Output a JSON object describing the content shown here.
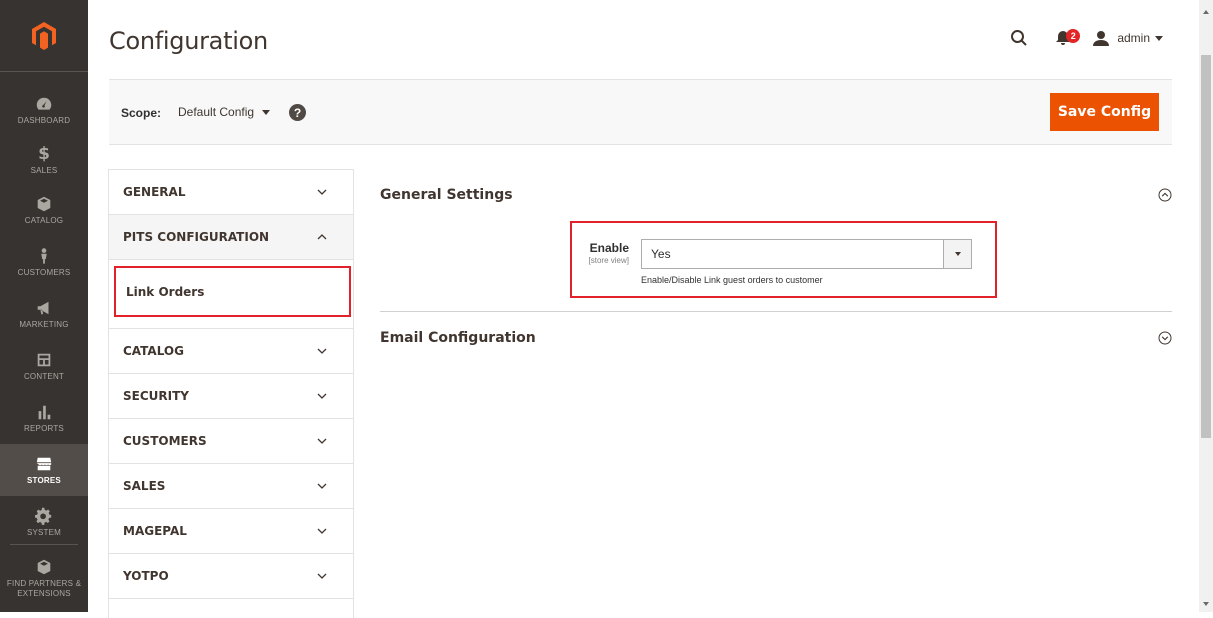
{
  "menu": {
    "items": [
      {
        "label": "DASHBOARD",
        "icon": "dashboard-icon"
      },
      {
        "label": "SALES",
        "icon": "dollar-icon"
      },
      {
        "label": "CATALOG",
        "icon": "box-icon"
      },
      {
        "label": "CUSTOMERS",
        "icon": "person-icon"
      },
      {
        "label": "MARKETING",
        "icon": "megaphone-icon"
      },
      {
        "label": "CONTENT",
        "icon": "layout-icon"
      },
      {
        "label": "REPORTS",
        "icon": "bar-chart-icon"
      },
      {
        "label": "STORES",
        "icon": "store-icon"
      },
      {
        "label": "SYSTEM",
        "icon": "gear-icon"
      },
      {
        "label": "FIND PARTNERS & EXTENSIONS",
        "icon": "cube-icon"
      }
    ],
    "active": "STORES"
  },
  "header": {
    "title": "Configuration",
    "notification_count": "2",
    "user": "admin"
  },
  "scope": {
    "label": "Scope:",
    "value": "Default Config",
    "help": "?",
    "save_label": "Save Config"
  },
  "tabs": {
    "items": [
      "GENERAL",
      "PITS CONFIGURATION",
      "CATALOG",
      "SECURITY",
      "CUSTOMERS",
      "SALES",
      "MAGEPAL",
      "YOTPO"
    ],
    "subitem": "Link Orders"
  },
  "sections": {
    "general": {
      "title": "General Settings",
      "field_label": "Enable",
      "field_scope": "[store view]",
      "field_value": "Yes",
      "field_note": "Enable/Disable Link guest orders to customer"
    },
    "email": {
      "title": "Email Configuration"
    }
  },
  "colors": {
    "menu_bg": "#373330",
    "accent": "#eb5202",
    "highlight": "#e2212b"
  }
}
